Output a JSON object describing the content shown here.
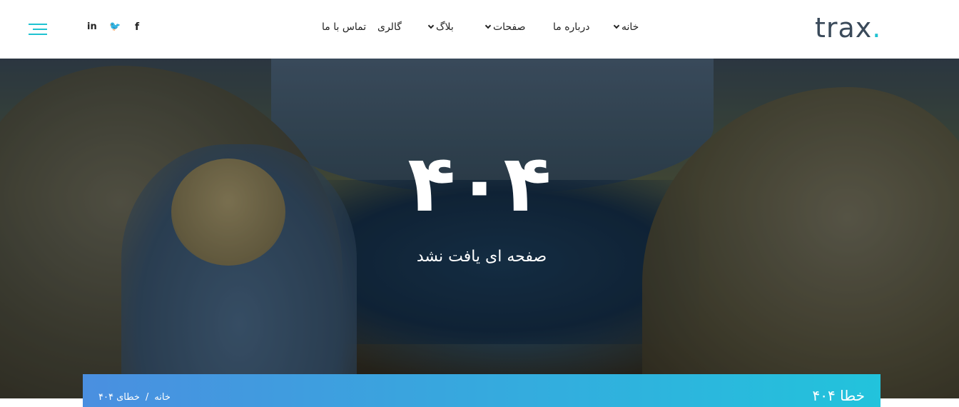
{
  "brand": {
    "logo_text": "trax",
    "logo_dot": ".",
    "accent": "#1fc2d1"
  },
  "nav": {
    "items": [
      {
        "label": "خانه",
        "has_dropdown": true
      },
      {
        "label": "درباره ما",
        "has_dropdown": false
      },
      {
        "label": "صفحات",
        "has_dropdown": true
      },
      {
        "label": "بلاگ",
        "has_dropdown": true
      },
      {
        "label": "گالری",
        "has_dropdown": false
      },
      {
        "label": "تماس با ما",
        "has_dropdown": false
      }
    ]
  },
  "social": {
    "facebook": "f",
    "twitter": "🐦",
    "linkedin": "in"
  },
  "hero": {
    "code": "۴۰۴",
    "message": "صفحه ای یافت نشد"
  },
  "breadcrumb_bar": {
    "title": "خطا ۴۰۴",
    "crumbs": [
      "خانه",
      "/",
      "خطای ۴۰۴"
    ],
    "gradient_start": "#4a8fe0",
    "gradient_end": "#22c3dc"
  }
}
